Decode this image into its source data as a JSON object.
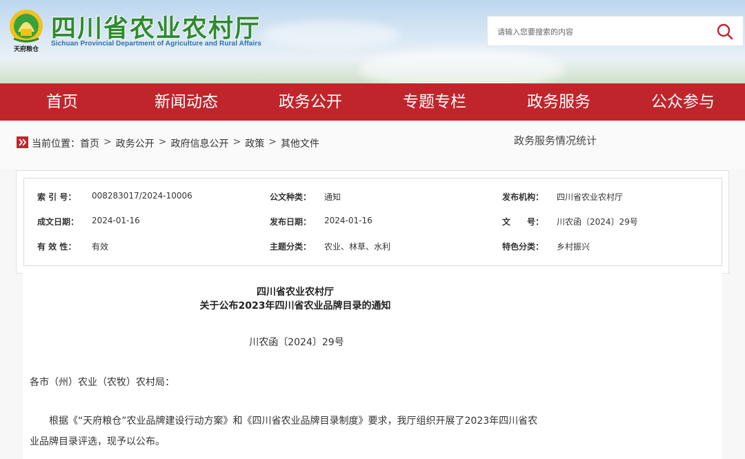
{
  "header": {
    "emblem_text": "天府粮仓",
    "site_title": "四川省农业农村厅",
    "site_subtitle": "Sichuan Provincial Department of Agriculture and Rural Affairs",
    "search_placeholder": "请输入您要搜索的内容"
  },
  "nav": [
    "首页",
    "新闻动态",
    "政务公开",
    "专题专栏",
    "政务服务",
    "公众参与"
  ],
  "breadcrumb": {
    "label": "当前位置：",
    "items": [
      "首页",
      "政务公开",
      "政府信息公开",
      "政策",
      "其他文件"
    ],
    "sep": ">"
  },
  "stats_link": "政务服务情况统计",
  "info": {
    "index_label": "索 引 号：",
    "index_value": "008283017/2024-10006",
    "type_label": "公文种类：",
    "type_value": "通知",
    "org_label": "发布机构：",
    "org_value": "四川省农业农村厅",
    "made_label": "成文日期：",
    "made_value": "2024-01-16",
    "pub_label": "发布日期：",
    "pub_value": "2024-01-16",
    "docno_label": "文　　号：",
    "docno_value": "川农函〔2024〕29号",
    "valid_label": "有 效 性：",
    "valid_value": "有效",
    "topic_label": "主题分类：",
    "topic_value": "农业、林草、水利",
    "feature_label": "特色分类：",
    "feature_value": "乡村振兴"
  },
  "document": {
    "title_line1": "四川省农业农村厅",
    "title_line2": "关于公布2023年四川省农业品牌目录的通知",
    "doc_number": "川农函〔2024〕29号",
    "salutation": "各市（州）农业（农牧）农村局：",
    "para1_line1": "根据《“天府粮仓”农业品牌建设行动方案》和《四川省农业品牌目录制度》要求，我厅组织开展了2023年四川省农",
    "para1_line2": "业品牌目录评选，现予以公布。"
  },
  "colors": {
    "nav_red": "#c0252b",
    "title_green": "#2f8a2f",
    "subtitle_blue": "#2f6fae"
  }
}
